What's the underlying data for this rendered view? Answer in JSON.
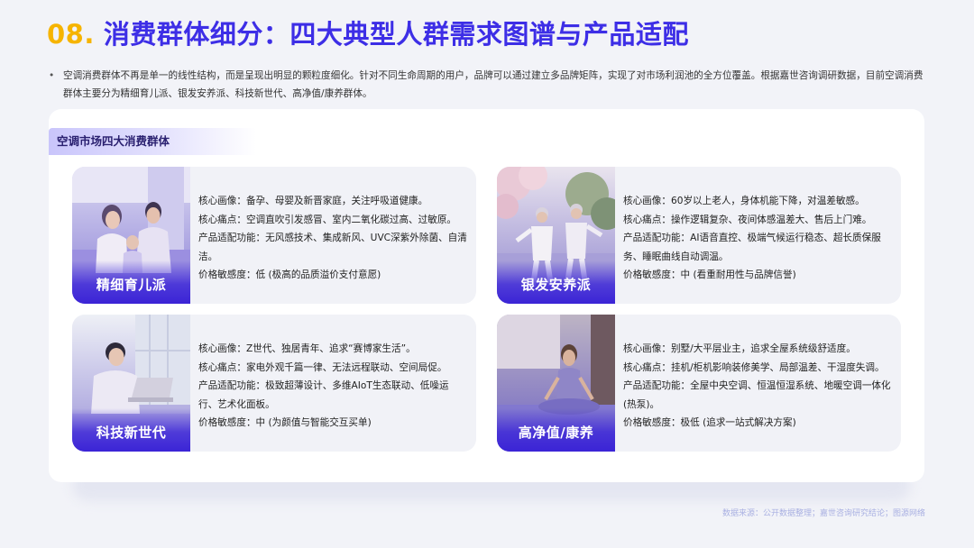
{
  "title": {
    "number": "08.",
    "text": "消费群体细分：四大典型人群需求图谱与产品适配"
  },
  "intro": {
    "bullet": "•",
    "text": "空调消费群体不再是单一的线性结构，而是呈现出明显的颗粒度细化。针对不同生命周期的用户，品牌可以通过建立多品牌矩阵，实现了对市场利润池的全方位覆盖。根据嘉世咨询调研数据，目前空调消费群体主要分为精细育儿派、银发安养派、科技新世代、高净值/康养群体。"
  },
  "panel_label": "空调市场四大消费群体",
  "groups": [
    {
      "name": "精细育儿派",
      "lines": [
        "核心画像：备孕、母婴及新晋家庭，关注呼吸道健康。",
        "核心痛点：空调直吹引发感冒、室内二氧化碳过高、过敏原。",
        "产品适配功能：无风感技术、集成新风、UVC深紫外除菌、自清洁。",
        "价格敏感度：低 (极高的品质溢价支付意愿)"
      ]
    },
    {
      "name": "银发安养派",
      "lines": [
        "核心画像：60岁以上老人，身体机能下降，对温差敏感。",
        "核心痛点：操作逻辑复杂、夜间体感温差大、售后上门难。",
        "产品适配功能：AI语音直控、极端气候运行稳态、超长质保服务、睡眠曲线自动调温。",
        "价格敏感度：中 (看重耐用性与品牌信誉)"
      ]
    },
    {
      "name": "科技新世代",
      "lines": [
        "核心画像：Z世代、独居青年、追求“赛博家生活”。",
        "核心痛点：家电外观千篇一律、无法远程联动、空间局促。",
        "产品适配功能：极致超薄设计、多维AIoT生态联动、低噪运行、艺术化面板。",
        "价格敏感度：中 (为颜值与智能交互买单)"
      ]
    },
    {
      "name": "高净值/康养",
      "lines": [
        "核心画像：别墅/大平层业主，追求全屋系统级舒适度。",
        "核心痛点：挂机/柜机影响装修美学、局部温差、干湿度失调。",
        "产品适配功能：全屋中央空调、恒温恒湿系统、地暖空调一体化(热泵)。",
        "价格敏感度：极低 (追求一站式解决方案)"
      ]
    }
  ],
  "source": "数据来源：公开数据整理；嘉世咨询研究结论；图源网络",
  "colors": {
    "brand_blue": "#3d2ee6",
    "accent_yellow": "#f6b400"
  }
}
